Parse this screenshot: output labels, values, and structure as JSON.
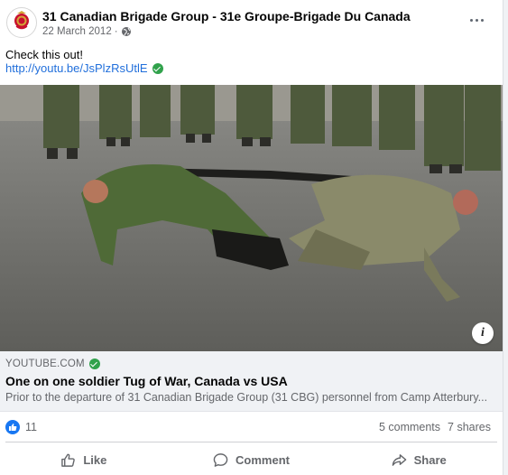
{
  "post": {
    "page_name": "31 Canadian Brigade Group - 31e Groupe-Brigade Du Canada",
    "date": "22 March 2012",
    "separator": "·",
    "audience_icon": "globe-icon",
    "text": "Check this out!",
    "link_url": "http://youtu.be/JsPlzRsUtlE"
  },
  "avatar": {
    "badge_text": "Canada"
  },
  "link_preview": {
    "domain": "YOUTUBE.COM",
    "title": "One on one soldier Tug of War, Canada vs USA",
    "description": "Prior to the departure of 31 Canadian Brigade Group (31 CBG) personnel from Camp Atterbury..."
  },
  "media": {
    "info_label": "i"
  },
  "stats": {
    "like_count": "11",
    "comments": "5 comments",
    "shares": "7 shares"
  },
  "actions": {
    "like": "Like",
    "comment": "Comment",
    "share": "Share"
  },
  "colors": {
    "link": "#216fdb",
    "verified": "#31a24c",
    "like_blue": "#1877f2",
    "muted": "#65676b"
  }
}
